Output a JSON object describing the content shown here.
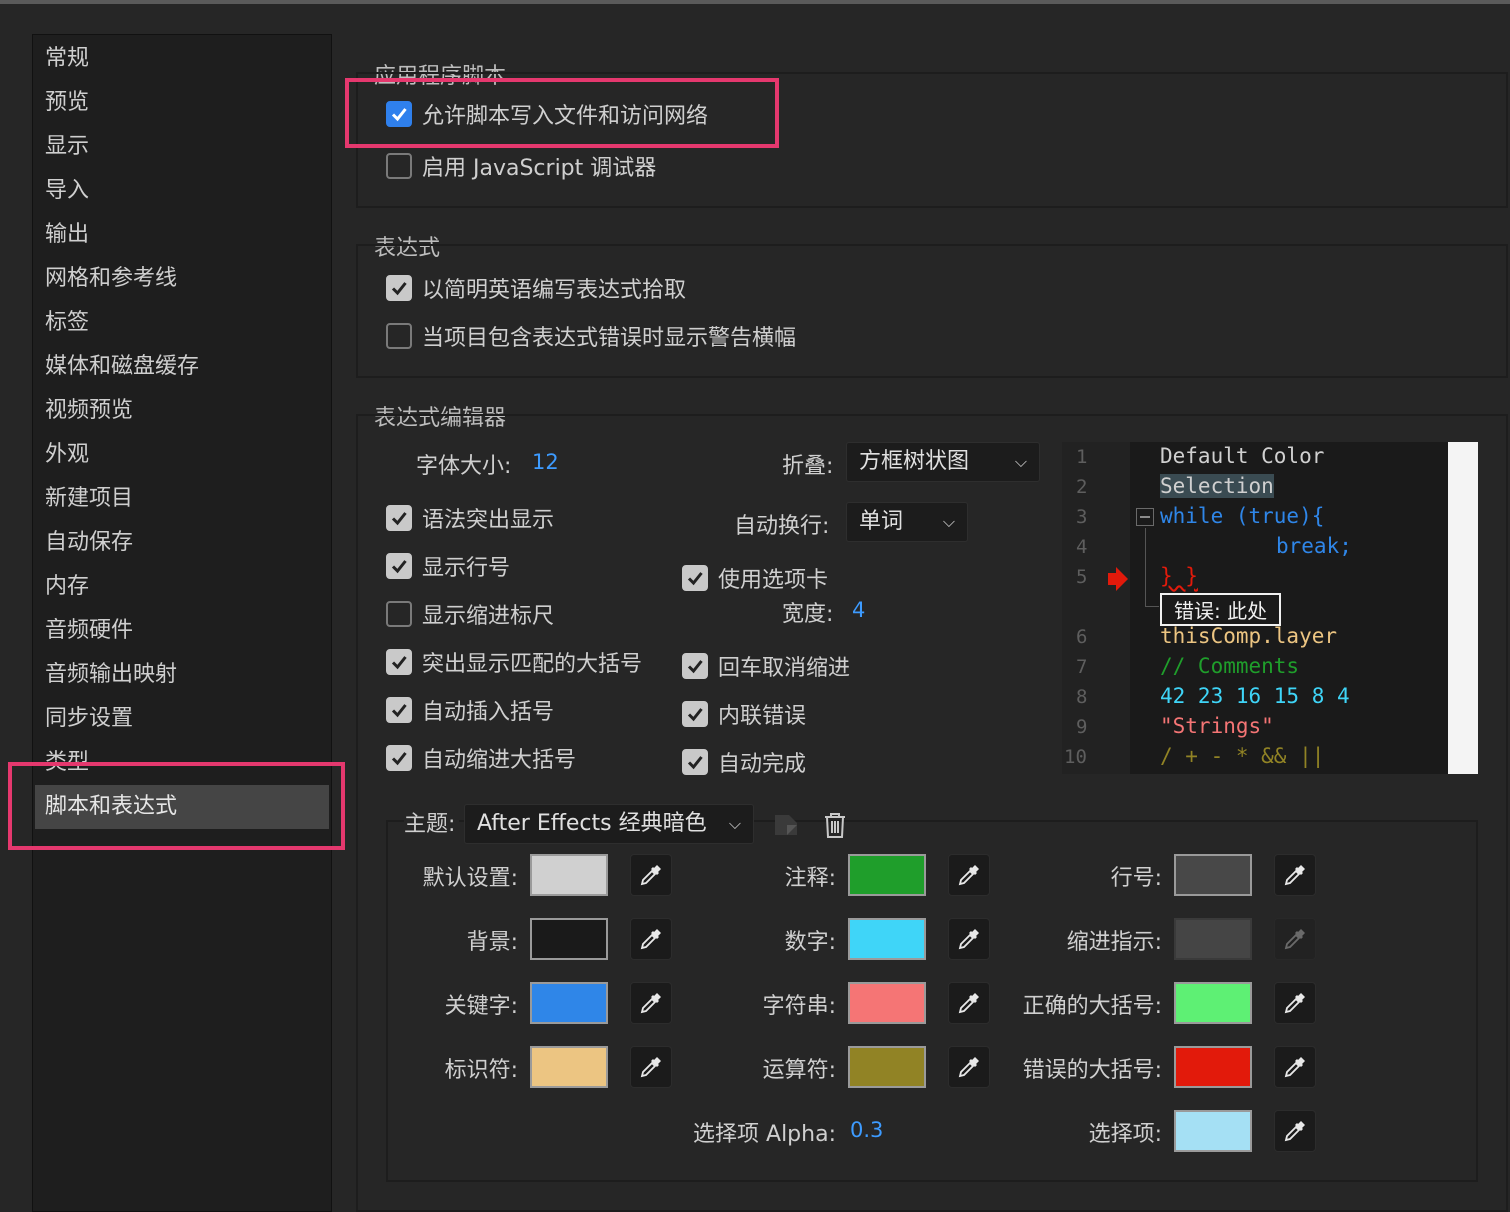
{
  "sidebar": {
    "items": [
      {
        "label": "常规"
      },
      {
        "label": "预览"
      },
      {
        "label": "显示"
      },
      {
        "label": "导入"
      },
      {
        "label": "输出"
      },
      {
        "label": "网格和参考线"
      },
      {
        "label": "标签"
      },
      {
        "label": "媒体和磁盘缓存"
      },
      {
        "label": "视频预览"
      },
      {
        "label": "外观"
      },
      {
        "label": "新建项目"
      },
      {
        "label": "自动保存"
      },
      {
        "label": "内存"
      },
      {
        "label": "音频硬件"
      },
      {
        "label": "音频输出映射"
      },
      {
        "label": "同步设置"
      },
      {
        "label": "类型"
      },
      {
        "label": "脚本和表达式"
      }
    ],
    "selected": "脚本和表达式"
  },
  "app_scripting": {
    "title": "应用程序脚本",
    "allow_write_network": {
      "label": "允许脚本写入文件和访问网络",
      "checked": true
    },
    "enable_js_debugger": {
      "label": "启用 JavaScript 调试器",
      "checked": false
    }
  },
  "expressions": {
    "title": "表达式",
    "plain_english_pickwhip": {
      "label": "以简明英语编写表达式拾取",
      "checked": true
    },
    "show_warning_banner": {
      "label": "当项目包含表达式错误时显示警告横幅",
      "checked": false
    }
  },
  "editor": {
    "title": "表达式编辑器",
    "font_size_label": "字体大小:",
    "font_size_value": "12",
    "fold_label": "折叠:",
    "fold_value": "方框树状图",
    "wrap_label": "自动换行:",
    "wrap_value": "单词",
    "tab_width_label": "宽度:",
    "tab_width_value": "4",
    "syntax_highlight": {
      "label": "语法突出显示",
      "checked": true
    },
    "line_numbers": {
      "label": "显示行号",
      "checked": true
    },
    "indent_ruler": {
      "label": "显示缩进标尺",
      "checked": false
    },
    "match_brackets": {
      "label": "突出显示匹配的大括号",
      "checked": true
    },
    "auto_insert_brackets": {
      "label": "自动插入括号",
      "checked": true
    },
    "auto_indent_braces": {
      "label": "自动缩进大括号",
      "checked": true
    },
    "use_tabs": {
      "label": "使用选项卡",
      "checked": true
    },
    "return_unindent": {
      "label": "回车取消缩进",
      "checked": true
    },
    "inline_errors": {
      "label": "内联错误",
      "checked": true
    },
    "autocomplete": {
      "label": "自动完成",
      "checked": true
    }
  },
  "preview": {
    "line_numbers": [
      "1",
      "2",
      "3",
      "4",
      "5",
      "6",
      "7",
      "8",
      "9",
      "10"
    ],
    "lines": [
      "Default Color",
      "Selection",
      "while (true){",
      "break;",
      "} }",
      "错误: 此处",
      "thisComp.layer",
      "// Comments",
      "42 23 16 15 8 4",
      "\"Strings\"",
      "/ + - * && ||"
    ]
  },
  "theme": {
    "label": "主题:",
    "value": "After Effects 经典暗色",
    "default_label": "默认设置:",
    "background_label": "背景:",
    "keyword_label": "关键字:",
    "identifier_label": "标识符:",
    "comment_label": "注释:",
    "number_label": "数字:",
    "string_label": "字符串:",
    "operator_label": "运算符:",
    "line_number_label": "行号:",
    "indent_guide_label": "缩进指示:",
    "correct_brace_label": "正确的大括号:",
    "error_brace_label": "错误的大括号:",
    "selection_alpha_label": "选择项 Alpha:",
    "selection_alpha_value": "0.3",
    "selection_label": "选择项:"
  },
  "colors": {
    "default": "#d0d0d0",
    "background": "#1a1a1a",
    "keyword": "#2f86e8",
    "identifier": "#ecc582",
    "comment": "#1f9e2b",
    "number": "#3fd5f8",
    "string": "#f57575",
    "operator": "#918325",
    "line_number": "#484848",
    "indent_guide": "#454545",
    "correct_brace": "#5ef074",
    "error_brace": "#e21a0b",
    "selection": "#a5e0f4",
    "highlight": "#e5386e",
    "checkbox_accent": "#2f80ed"
  },
  "icons": {
    "picker": "eyedropper-icon",
    "new_theme": "new-theme-icon",
    "delete": "trash-icon",
    "error_marker": "error-arrow-icon"
  }
}
